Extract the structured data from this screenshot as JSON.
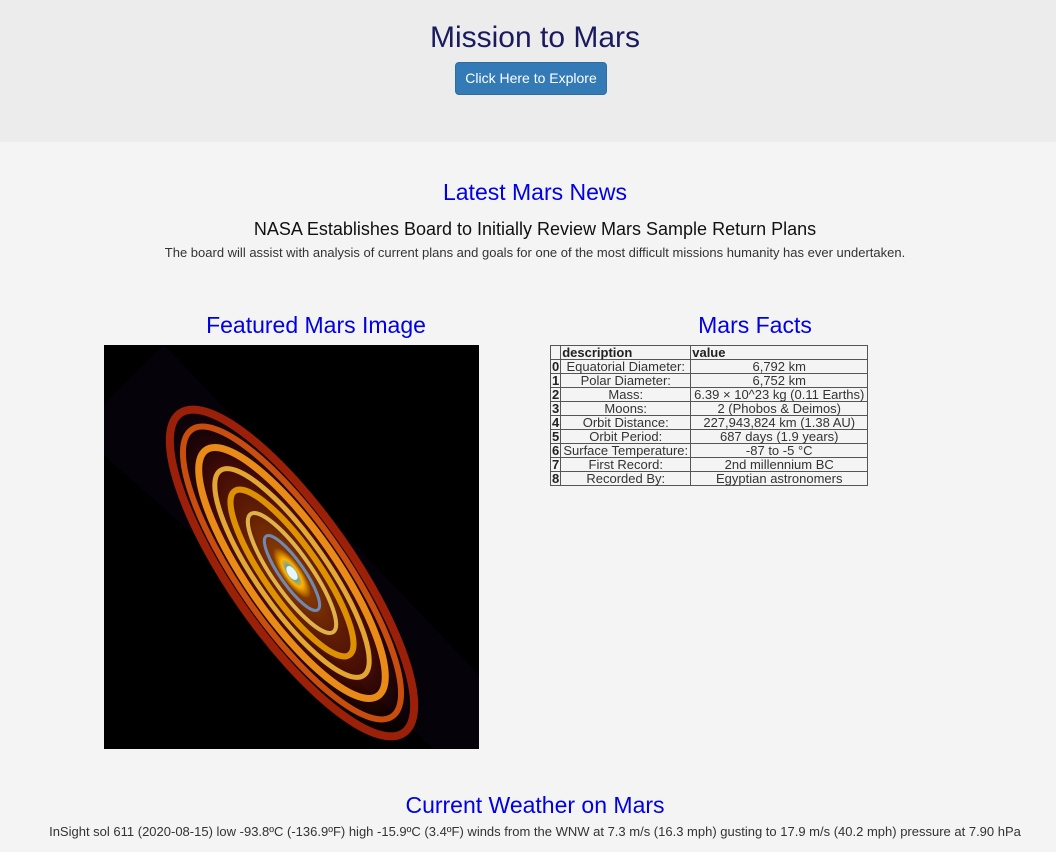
{
  "header": {
    "title": "Mission to Mars",
    "explore_button": "Click Here to Explore"
  },
  "news": {
    "section_title": "Latest Mars News",
    "headline": "NASA Establishes Board to Initially Review Mars Sample Return Plans",
    "teaser": "The board will assist with analysis of current plans and goals for one of the most difficult missions humanity has ever undertaken."
  },
  "featured_image": {
    "section_title": "Featured Mars Image",
    "alt": "spiral galaxy"
  },
  "facts": {
    "section_title": "Mars Facts",
    "columns": [
      "",
      "description",
      "value"
    ],
    "rows": [
      {
        "index": "0",
        "description": "Equatorial Diameter:",
        "value": "6,792 km"
      },
      {
        "index": "1",
        "description": "Polar Diameter:",
        "value": "6,752 km"
      },
      {
        "index": "2",
        "description": "Mass:",
        "value": "6.39 × 10^23 kg (0.11 Earths)"
      },
      {
        "index": "3",
        "description": "Moons:",
        "value": "2 (Phobos & Deimos)"
      },
      {
        "index": "4",
        "description": "Orbit Distance:",
        "value": "227,943,824 km (1.38 AU)"
      },
      {
        "index": "5",
        "description": "Orbit Period:",
        "value": "687 days (1.9 years)"
      },
      {
        "index": "6",
        "description": "Surface Temperature:",
        "value": "-87 to -5 °C"
      },
      {
        "index": "7",
        "description": "First Record:",
        "value": "2nd millennium BC"
      },
      {
        "index": "8",
        "description": "Recorded By:",
        "value": "Egyptian astronomers"
      }
    ]
  },
  "weather": {
    "section_title": "Current Weather on Mars",
    "text": "InSight sol 611 (2020-08-15) low -93.8ºC (-136.9ºF) high -15.9ºC (3.4ºF) winds from the WNW at 7.3 m/s (16.3 mph) gusting to 17.9 m/s (40.2 mph) pressure at 7.90 hPa"
  },
  "colors": {
    "jumbotron_bg": "#ececec",
    "page_bg": "#f4f4f4",
    "title_color": "#1a1a5e",
    "section_title_color": "#0000e6",
    "button_bg": "#337ab7"
  }
}
